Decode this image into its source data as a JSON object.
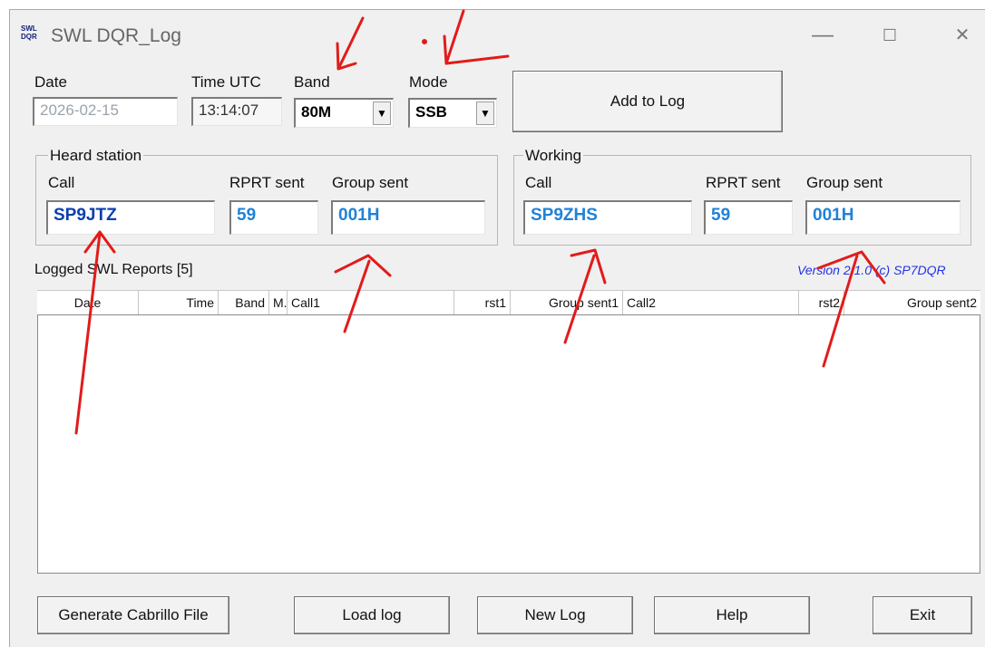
{
  "window": {
    "title": "SWL DQR_Log",
    "icon_text": "SWL DQR",
    "controls": {
      "minimize": "—",
      "maximize": "☐",
      "close": "✕"
    }
  },
  "form": {
    "date_label": "Date",
    "date_value": "2026-02-15",
    "time_label": "Time UTC",
    "time_value": "13:14:07",
    "band_label": "Band",
    "band_value": "80M",
    "mode_label": "Mode",
    "mode_value": "SSB",
    "add_button": "Add to Log"
  },
  "heard": {
    "group_title": "Heard  station",
    "call_label": "Call",
    "call_value": "SP9JTZ",
    "rprt_label": "RPRT sent",
    "rprt_value": "59",
    "group_label": "Group sent",
    "group_value": "001H"
  },
  "working": {
    "group_title": "Working",
    "call_label": "Call",
    "call_value": "SP9ZHS",
    "rprt_label": "RPRT sent",
    "rprt_value": "59",
    "group_label": "Group sent",
    "group_value": "001H"
  },
  "log": {
    "title": "Logged SWL Reports  [5]",
    "version": "Version 2.1.0 (c) SP7DQR",
    "columns": [
      "Date",
      "Time",
      "Band",
      "M.",
      "Call1",
      "rst1",
      "Group sent1",
      "Call2",
      "rst2",
      "Group sent2"
    ]
  },
  "buttons": {
    "cabrillo": "Generate Cabrillo File",
    "load": "Load log",
    "new": "New Log",
    "help": "Help",
    "exit": "Exit"
  },
  "colors": {
    "annotation": "#e21b1b",
    "callsign": "#0a3fae",
    "report_value": "#1f82d8",
    "version": "#2131e8"
  }
}
